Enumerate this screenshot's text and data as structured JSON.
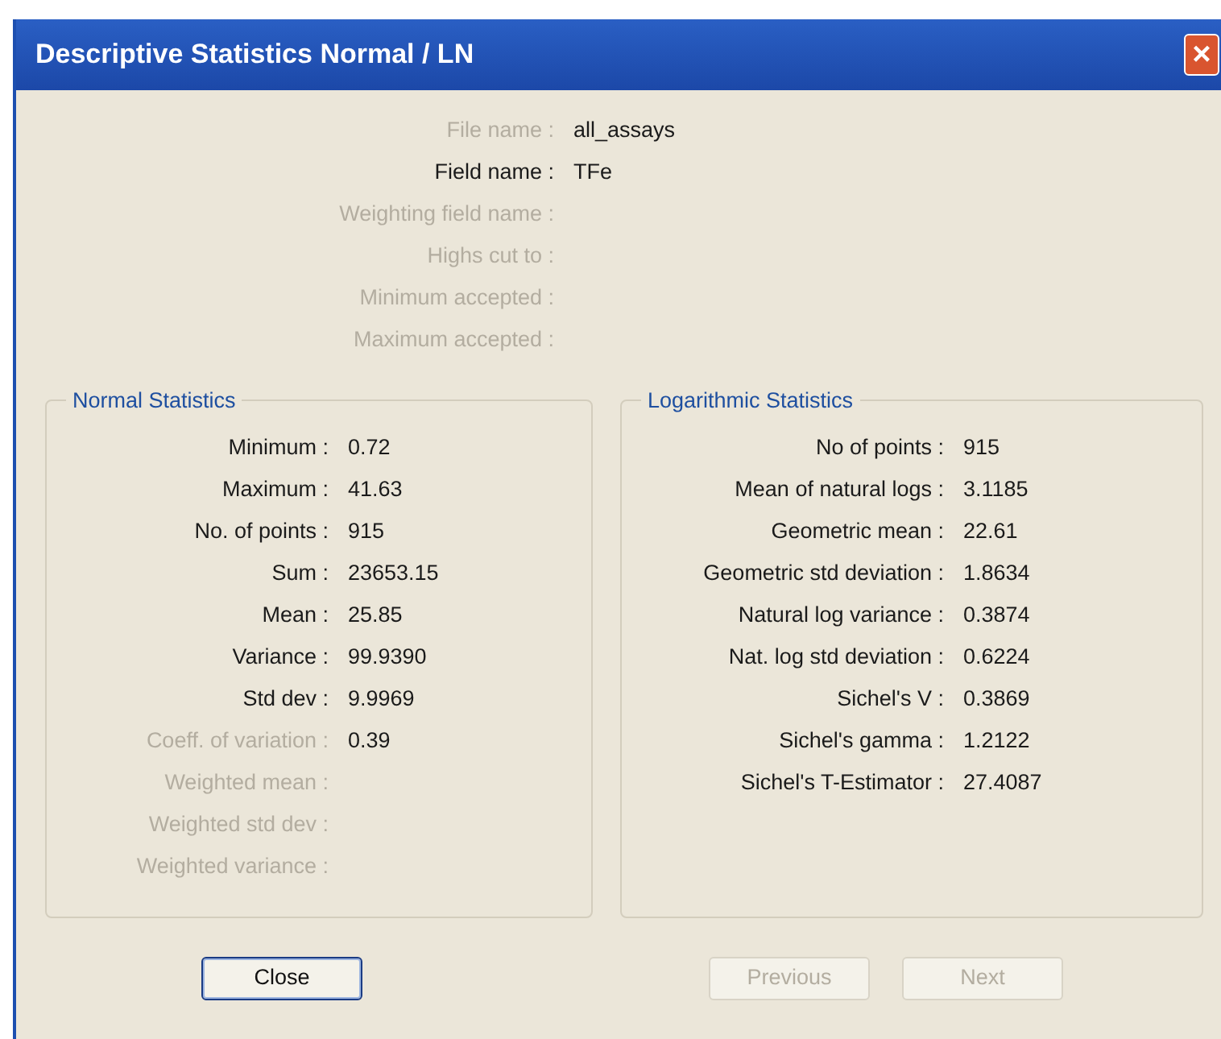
{
  "window": {
    "title": "Descriptive Statistics Normal / LN",
    "close_icon": "×"
  },
  "header_fields": [
    {
      "label": "File name :",
      "value": "all_assays",
      "disabled": true
    },
    {
      "label": "Field name :",
      "value": "TFe",
      "disabled": false
    },
    {
      "label": "Weighting field name :",
      "disabled": true
    },
    {
      "label": "Highs cut to :",
      "disabled": true
    },
    {
      "label": "Minimum accepted :",
      "disabled": true
    },
    {
      "label": "Maximum accepted :",
      "disabled": true
    }
  ],
  "groups": [
    {
      "title": "Normal Statistics",
      "rows": [
        {
          "label": "Minimum :",
          "value": "0.72",
          "disabled": false
        },
        {
          "label": "Maximum :",
          "value": "41.63",
          "disabled": false
        },
        {
          "label": "No. of points :",
          "value": "915",
          "disabled": false
        },
        {
          "label": "Sum :",
          "value": "23653.15",
          "disabled": false
        },
        {
          "label": "Mean :",
          "value": "25.85",
          "disabled": false
        },
        {
          "label": "Variance :",
          "value": "99.9390",
          "disabled": false
        },
        {
          "label": "Std dev :",
          "value": "9.9969",
          "disabled": false
        },
        {
          "label": "Coeff. of variation :",
          "value": "0.39",
          "disabled": true
        },
        {
          "label": "Weighted mean :",
          "disabled": true
        },
        {
          "label": "Weighted std dev :",
          "disabled": true
        },
        {
          "label": "Weighted variance :",
          "disabled": true
        }
      ]
    },
    {
      "title": "Logarithmic Statistics",
      "rows": [
        {
          "label": "No of points :",
          "value": "915",
          "disabled": false
        },
        {
          "label": "Mean of natural logs :",
          "value": "3.1185",
          "disabled": false
        },
        {
          "label": "Geometric mean :",
          "value": "22.61",
          "disabled": false
        },
        {
          "label": "Geometric std deviation :",
          "value": "1.8634",
          "disabled": false
        },
        {
          "label": "Natural log variance :",
          "value": "0.3874",
          "disabled": false
        },
        {
          "label": "Nat. log std deviation :",
          "value": "0.6224",
          "disabled": false
        },
        {
          "label": "Sichel's V :",
          "value": "0.3869",
          "disabled": false
        },
        {
          "label": "Sichel's gamma :",
          "value": "1.2122",
          "disabled": false
        },
        {
          "label": "Sichel's T-Estimator :",
          "value": "27.4087",
          "disabled": false
        }
      ]
    }
  ],
  "buttons": [
    {
      "label": "Close",
      "disabled": false
    },
    {
      "label": "Previous",
      "disabled": true
    },
    {
      "label": "Next",
      "disabled": true
    }
  ]
}
